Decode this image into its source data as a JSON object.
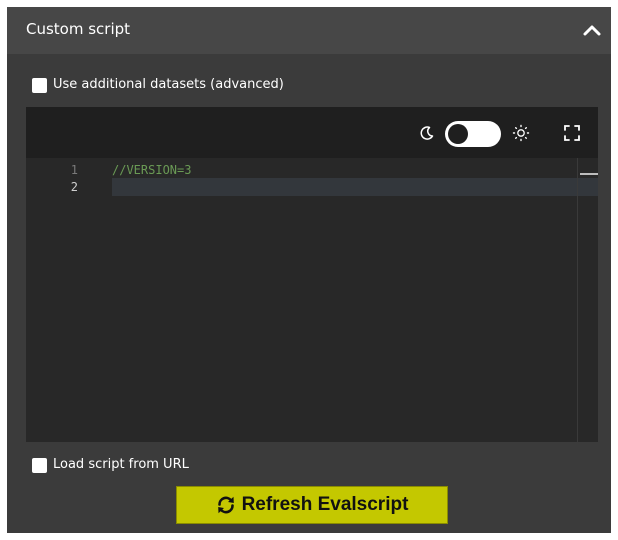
{
  "panel": {
    "title": "Custom script",
    "collapse_icon": "chevron-up-icon"
  },
  "options": {
    "datasets_label": "Use additional datasets (advanced)",
    "datasets_checked": false,
    "load_url_label": "Load script from URL",
    "load_url_checked": false
  },
  "editor": {
    "theme_dark_icon": "moon-icon",
    "theme_light_icon": "sun-icon",
    "theme_toggle_state": "dark",
    "fullscreen_icon": "expand-icon",
    "lines": [
      {
        "number": "1",
        "text": "//VERSION=3"
      },
      {
        "number": "2",
        "text": ""
      }
    ]
  },
  "actions": {
    "refresh_label": "Refresh Evalscript",
    "refresh_icon": "refresh-icon"
  },
  "colors": {
    "panel_bg": "#3b3b3b",
    "editor_bg": "#282828",
    "comment_green": "#6a9a55",
    "button_accent": "#c4c800"
  }
}
